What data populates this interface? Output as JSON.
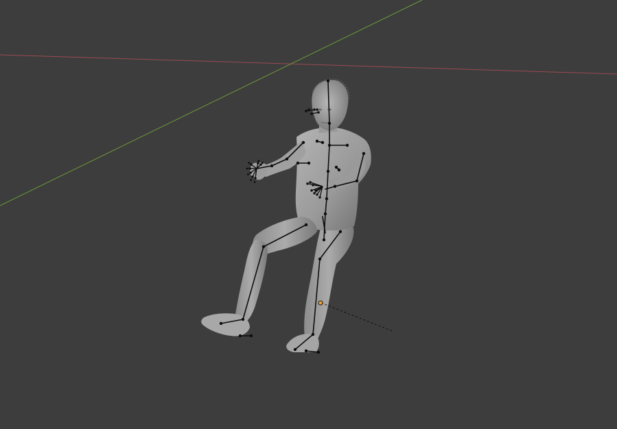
{
  "viewport": {
    "background": "#3d3d3d",
    "axis_x_color": "#9b4a52",
    "axis_y_color": "#6d9a3a",
    "mesh_color": "#9e9e9e",
    "mesh_shadow": "#707070",
    "bone_color": "#0d0d0d",
    "origin_color": "#f0a030",
    "relationship_line_color": "#111111"
  },
  "scene": {
    "object": "human-figure-seated",
    "armature": "human-armature",
    "selected_origin": "object-origin"
  }
}
